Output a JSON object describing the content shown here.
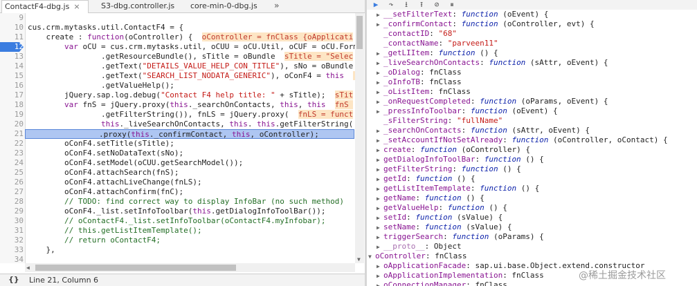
{
  "tabs": [
    {
      "label": "ContactF4-dbg.js",
      "active": true
    },
    {
      "label": "S3-dbg.controller.js",
      "active": false
    },
    {
      "label": "core-min-0-dbg.js",
      "active": false
    }
  ],
  "tab_overflow": "»",
  "tab_close": "×",
  "gutter": {
    "line_numbers": [
      "9",
      "10",
      "11",
      "12",
      "13",
      "14",
      "15",
      "16",
      "17",
      "18",
      "19",
      "20",
      "21",
      "22",
      "23",
      "24",
      "25",
      "26",
      "27",
      "28",
      "29",
      "30",
      "31",
      "32",
      "33",
      "34",
      "35"
    ],
    "breakpoint_line": "12",
    "exec_line": "21"
  },
  "code_lines": [
    {
      "n": "9",
      "segs": [
        [
          "",
          ""
        ]
      ]
    },
    {
      "n": "10",
      "segs": [
        [
          "",
          "cus.crm.mytasks.util.ContactF4 = {"
        ]
      ]
    },
    {
      "n": "11",
      "segs": [
        [
          "",
          "    create : "
        ],
        [
          "kw",
          "function"
        ],
        [
          "",
          "(oController) {  "
        ],
        [
          "inl",
          "oController = fnClass {oApplicati"
        ]
      ]
    },
    {
      "n": "12",
      "segs": [
        [
          "",
          "        "
        ],
        [
          "kw",
          "var"
        ],
        [
          "",
          " oCU = cus.crm.mytasks.util, oCUU = oCU.Util, oCUF = oCU.Form"
        ]
      ]
    },
    {
      "n": "13",
      "segs": [
        [
          "",
          "                .getResourceBundle(), sTitle = oBundle  "
        ],
        [
          "inl",
          "sTitle = \"Selec"
        ]
      ]
    },
    {
      "n": "14",
      "segs": [
        [
          "",
          "                .getText("
        ],
        [
          "str",
          "\"DETAILS_VALUE_HELP_CON_TITLE\""
        ],
        [
          "",
          "), sNo = oBundle"
        ]
      ]
    },
    {
      "n": "15",
      "segs": [
        [
          "",
          "                .getText("
        ],
        [
          "str",
          "\"SEARCH_LIST_NODATA_GENERIC\""
        ],
        [
          "",
          "), oConF4 = "
        ],
        [
          "this",
          "this"
        ],
        [
          "",
          "  "
        ],
        [
          "inl",
          "  "
        ]
      ]
    },
    {
      "n": "16",
      "segs": [
        [
          "",
          "                .getValueHelp();"
        ]
      ]
    },
    {
      "n": "17",
      "segs": [
        [
          "",
          "        jQuery.sap.log.debug("
        ],
        [
          "str",
          "\"Contact F4 help title: \""
        ],
        [
          "",
          " + sTitle);  "
        ],
        [
          "inl",
          "sTit"
        ]
      ]
    },
    {
      "n": "18",
      "segs": [
        [
          "",
          "        "
        ],
        [
          "kw",
          "var"
        ],
        [
          "",
          " fnS = jQuery.proxy("
        ],
        [
          "this",
          "this"
        ],
        [
          "",
          "._searchOnContacts, "
        ],
        [
          "this",
          "this"
        ],
        [
          "",
          ", "
        ],
        [
          "this",
          "this"
        ],
        [
          "",
          "  "
        ],
        [
          "inl",
          "fnS "
        ]
      ]
    },
    {
      "n": "19",
      "segs": [
        [
          "",
          "                .getFilterString()), fnLS = jQuery.proxy(  "
        ],
        [
          "inl",
          "fnLS = funct"
        ]
      ]
    },
    {
      "n": "20",
      "segs": [
        [
          "",
          "                "
        ],
        [
          "this",
          "this"
        ],
        [
          "",
          "._liveSearchOnContacts, "
        ],
        [
          "this",
          "this"
        ],
        [
          "",
          ". "
        ],
        [
          "this",
          "this"
        ],
        [
          "",
          ".getFilterString("
        ]
      ]
    },
    {
      "n": "21",
      "segs": [
        [
          "",
          "                .proxy("
        ],
        [
          "this",
          "this"
        ],
        [
          "",
          "._confirmContact, "
        ],
        [
          "this",
          "this"
        ],
        [
          "",
          ", oController);"
        ]
      ]
    },
    {
      "n": "22",
      "segs": [
        [
          "",
          "        oConF4.setTitle(sTitle);"
        ]
      ]
    },
    {
      "n": "23",
      "segs": [
        [
          "",
          "        oConF4.setNoDataText(sNo);"
        ]
      ]
    },
    {
      "n": "24",
      "segs": [
        [
          "",
          "        oConF4.setModel(oCUU.getSearchModel());"
        ]
      ]
    },
    {
      "n": "25",
      "segs": [
        [
          "",
          "        oConF4.attachSearch(fnS);"
        ]
      ]
    },
    {
      "n": "26",
      "segs": [
        [
          "",
          "        oConF4.attachLiveChange(fnLS);"
        ]
      ]
    },
    {
      "n": "27",
      "segs": [
        [
          "",
          "        oConF4.attachConfirm(fnC);"
        ]
      ]
    },
    {
      "n": "28",
      "segs": [
        [
          "cm",
          "        // TODO: find correct way to display InfoBar (no such method)"
        ]
      ]
    },
    {
      "n": "29",
      "segs": [
        [
          "",
          "        oConF4._list.setInfoToolbar("
        ],
        [
          "this",
          "this"
        ],
        [
          "",
          ".getDialogInfoToolBar());"
        ]
      ]
    },
    {
      "n": "30",
      "segs": [
        [
          "cm",
          "        // oContactF4._list.setInfoToolbar(oContactF4.myInfobar);"
        ]
      ]
    },
    {
      "n": "31",
      "segs": [
        [
          "cm",
          "        // this.getListItemTemplate();"
        ]
      ]
    },
    {
      "n": "32",
      "segs": [
        [
          "cm",
          "        // return oContactF4;"
        ]
      ]
    },
    {
      "n": "33",
      "segs": [
        [
          "",
          "    },"
        ]
      ]
    },
    {
      "n": "34",
      "segs": [
        [
          "",
          ""
        ]
      ]
    },
    {
      "n": "35",
      "segs": [
        [
          "",
          ""
        ]
      ]
    }
  ],
  "status": {
    "pretty_print": "{}",
    "cursor": "Line 21, Column 6"
  },
  "debugger_toolbar": [
    {
      "icon": "resume-icon",
      "glyph": "▶",
      "name": "resume-button"
    },
    {
      "icon": "step-over-icon",
      "glyph": "↷",
      "name": "step-over-button"
    },
    {
      "icon": "step-into-icon",
      "glyph": "⭳",
      "name": "step-into-button"
    },
    {
      "icon": "step-out-icon",
      "glyph": "⭱",
      "name": "step-out-button"
    },
    {
      "icon": "deactivate-breakpoints-icon",
      "glyph": "⊘",
      "name": "deactivate-breakpoints-button"
    },
    {
      "icon": "pause-on-exceptions-icon",
      "glyph": "⏸",
      "name": "pause-on-exceptions-button"
    }
  ],
  "scope_lines": [
    {
      "indent": 1,
      "tri": "▶",
      "segs": [
        [
          "pname",
          "__setFilterText"
        ],
        [
          "plain",
          ": "
        ],
        [
          "fnk",
          "function"
        ],
        [
          "plain",
          " (oEvent) {"
        ]
      ]
    },
    {
      "indent": 1,
      "tri": "▶",
      "segs": [
        [
          "pname",
          "_confirmContact"
        ],
        [
          "plain",
          ": "
        ],
        [
          "fnk",
          "function"
        ],
        [
          "plain",
          " (oController, evt) {"
        ]
      ]
    },
    {
      "indent": 1,
      "tri": "",
      "segs": [
        [
          "pname",
          "_contactID"
        ],
        [
          "plain",
          ": "
        ],
        [
          "sval",
          "\"68\""
        ]
      ]
    },
    {
      "indent": 1,
      "tri": "",
      "segs": [
        [
          "pname",
          "_contactName"
        ],
        [
          "plain",
          ": "
        ],
        [
          "sval",
          "\"parveen11\""
        ]
      ]
    },
    {
      "indent": 1,
      "tri": "▶",
      "segs": [
        [
          "pname",
          "_getLIItem"
        ],
        [
          "plain",
          ": "
        ],
        [
          "fnk",
          "function"
        ],
        [
          "plain",
          " () {"
        ]
      ]
    },
    {
      "indent": 1,
      "tri": "▶",
      "segs": [
        [
          "pname",
          "_liveSearchOnContacts"
        ],
        [
          "plain",
          ": "
        ],
        [
          "fnk",
          "function"
        ],
        [
          "plain",
          " (sAttr, oEvent) {"
        ]
      ]
    },
    {
      "indent": 1,
      "tri": "▶",
      "segs": [
        [
          "pname",
          "_oDialog"
        ],
        [
          "plain",
          ": fnClass"
        ]
      ]
    },
    {
      "indent": 1,
      "tri": "▶",
      "segs": [
        [
          "pname",
          "_oInfoTB"
        ],
        [
          "plain",
          ": fnClass"
        ]
      ]
    },
    {
      "indent": 1,
      "tri": "▶",
      "segs": [
        [
          "pname",
          "_oListItem"
        ],
        [
          "plain",
          ": fnClass"
        ]
      ]
    },
    {
      "indent": 1,
      "tri": "▶",
      "segs": [
        [
          "pname",
          "_onRequestCompleted"
        ],
        [
          "plain",
          ": "
        ],
        [
          "fnk",
          "function"
        ],
        [
          "plain",
          " (oParams, oEvent) {"
        ]
      ]
    },
    {
      "indent": 1,
      "tri": "▶",
      "segs": [
        [
          "pname",
          "_pressInfoToolbar"
        ],
        [
          "plain",
          ": "
        ],
        [
          "fnk",
          "function"
        ],
        [
          "plain",
          " (oEvent) {"
        ]
      ]
    },
    {
      "indent": 1,
      "tri": "",
      "segs": [
        [
          "pname",
          "_sFilterString"
        ],
        [
          "plain",
          ": "
        ],
        [
          "sval",
          "\"fullName\""
        ]
      ]
    },
    {
      "indent": 1,
      "tri": "▶",
      "segs": [
        [
          "pname",
          "_searchOnContacts"
        ],
        [
          "plain",
          ": "
        ],
        [
          "fnk",
          "function"
        ],
        [
          "plain",
          " (sAttr, oEvent) {"
        ]
      ]
    },
    {
      "indent": 1,
      "tri": "▶",
      "segs": [
        [
          "pname",
          "_setAccountIfNotSetAlready"
        ],
        [
          "plain",
          ": "
        ],
        [
          "fnk",
          "function"
        ],
        [
          "plain",
          " (oController, oContact) {"
        ]
      ]
    },
    {
      "indent": 1,
      "tri": "▶",
      "segs": [
        [
          "pname",
          "create"
        ],
        [
          "plain",
          ": "
        ],
        [
          "fnk",
          "function"
        ],
        [
          "plain",
          " (oController) {"
        ]
      ]
    },
    {
      "indent": 1,
      "tri": "▶",
      "segs": [
        [
          "pname",
          "getDialogInfoToolBar"
        ],
        [
          "plain",
          ": "
        ],
        [
          "fnk",
          "function"
        ],
        [
          "plain",
          " () {"
        ]
      ]
    },
    {
      "indent": 1,
      "tri": "▶",
      "segs": [
        [
          "pname",
          "getFilterString"
        ],
        [
          "plain",
          ": "
        ],
        [
          "fnk",
          "function"
        ],
        [
          "plain",
          " () {"
        ]
      ]
    },
    {
      "indent": 1,
      "tri": "▶",
      "segs": [
        [
          "pname",
          "getId"
        ],
        [
          "plain",
          ": "
        ],
        [
          "fnk",
          "function"
        ],
        [
          "plain",
          " () {"
        ]
      ]
    },
    {
      "indent": 1,
      "tri": "▶",
      "segs": [
        [
          "pname",
          "getListItemTemplate"
        ],
        [
          "plain",
          ": "
        ],
        [
          "fnk",
          "function"
        ],
        [
          "plain",
          " () {"
        ]
      ]
    },
    {
      "indent": 1,
      "tri": "▶",
      "segs": [
        [
          "pname",
          "getName"
        ],
        [
          "plain",
          ": "
        ],
        [
          "fnk",
          "function"
        ],
        [
          "plain",
          " () {"
        ]
      ]
    },
    {
      "indent": 1,
      "tri": "▶",
      "segs": [
        [
          "pname",
          "getValueHelp"
        ],
        [
          "plain",
          ": "
        ],
        [
          "fnk",
          "function"
        ],
        [
          "plain",
          " () {"
        ]
      ]
    },
    {
      "indent": 1,
      "tri": "▶",
      "segs": [
        [
          "pname",
          "setId"
        ],
        [
          "plain",
          ": "
        ],
        [
          "fnk",
          "function"
        ],
        [
          "plain",
          " (sValue) {"
        ]
      ]
    },
    {
      "indent": 1,
      "tri": "▶",
      "segs": [
        [
          "pname",
          "setName"
        ],
        [
          "plain",
          ": "
        ],
        [
          "fnk",
          "function"
        ],
        [
          "plain",
          " (sValue) {"
        ]
      ]
    },
    {
      "indent": 1,
      "tri": "▶",
      "segs": [
        [
          "pname",
          "triggerSearch"
        ],
        [
          "plain",
          ": "
        ],
        [
          "fnk",
          "function"
        ],
        [
          "plain",
          " (oParams) {"
        ]
      ]
    },
    {
      "indent": 1,
      "tri": "▶",
      "segs": [
        [
          "pname dim",
          "__proto__"
        ],
        [
          "plain",
          ": Object"
        ]
      ]
    },
    {
      "indent": 0,
      "tri": "▼",
      "segs": [
        [
          "pname",
          "oController"
        ],
        [
          "plain",
          ": fnClass"
        ]
      ]
    },
    {
      "indent": 1,
      "tri": "▶",
      "segs": [
        [
          "pname",
          "oApplicationFacade"
        ],
        [
          "plain",
          ": sap.ui.base.Object.extend.constructor"
        ]
      ]
    },
    {
      "indent": 1,
      "tri": "▶",
      "segs": [
        [
          "pname",
          "oApplicationImplementation"
        ],
        [
          "plain",
          ": fnClass"
        ]
      ]
    },
    {
      "indent": 1,
      "tri": "▶",
      "segs": [
        [
          "pname",
          "oConnectionManager"
        ],
        [
          "plain",
          ": fnClass"
        ]
      ]
    }
  ],
  "watermark": "@稀土掘金技术社区",
  "colors": {
    "breakpoint": "#3b7de0",
    "exec_highlight": "#aec6f2",
    "keyword": "#881391",
    "string": "#c41a16"
  }
}
